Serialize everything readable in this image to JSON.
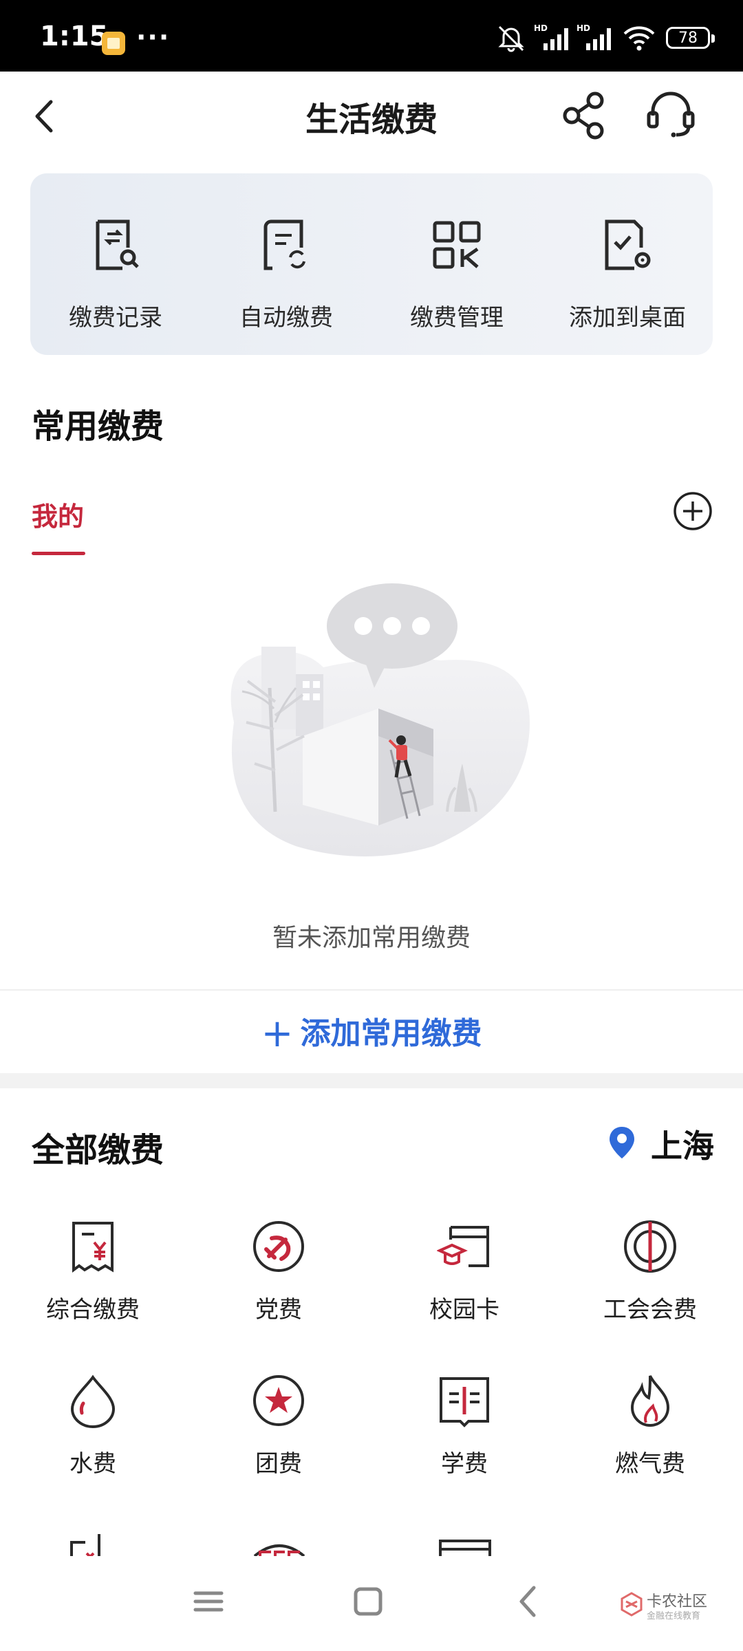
{
  "status_bar": {
    "time": "1:15",
    "dots": "···",
    "battery": "78",
    "network_label_1": "HD",
    "network_label_2": "HD"
  },
  "header": {
    "title": "生活缴费"
  },
  "quick_actions": [
    {
      "label": "缴费记录",
      "icon": "payment-record-icon"
    },
    {
      "label": "自动缴费",
      "icon": "auto-pay-icon"
    },
    {
      "label": "缴费管理",
      "icon": "payment-manage-icon"
    },
    {
      "label": "添加到桌面",
      "icon": "add-to-desktop-icon"
    }
  ],
  "common": {
    "title": "常用缴费",
    "tab_mine": "我的",
    "empty_text": "暂未添加常用缴费",
    "add_label": "添加常用缴费",
    "add_plus": "+"
  },
  "all": {
    "title": "全部缴费",
    "location": "上海",
    "items": [
      {
        "label": "综合缴费",
        "icon": "receipt-yuan-icon"
      },
      {
        "label": "党费",
        "icon": "party-emblem-icon"
      },
      {
        "label": "校园卡",
        "icon": "campus-card-icon"
      },
      {
        "label": "工会会费",
        "icon": "union-emblem-icon"
      },
      {
        "label": "水费",
        "icon": "water-drop-icon"
      },
      {
        "label": "团费",
        "icon": "league-star-icon"
      },
      {
        "label": "学费",
        "icon": "tuition-book-icon"
      },
      {
        "label": "燃气费",
        "icon": "gas-flame-icon"
      }
    ]
  },
  "watermark": {
    "title": "卡农社区",
    "subtitle": "金融在线教育"
  },
  "colors": {
    "accent_red": "#c5283d",
    "link_blue": "#2f6ad9",
    "icon_dark": "#2a2a2a"
  }
}
